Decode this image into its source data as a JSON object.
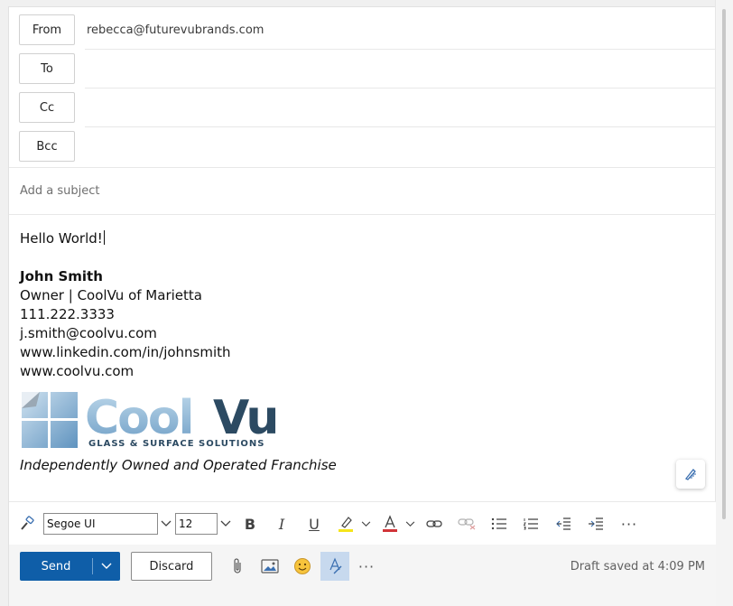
{
  "header": {
    "from_label": "From",
    "from_value": "rebecca@futurevubrands.com",
    "to_label": "To",
    "cc_label": "Cc",
    "bcc_label": "Bcc",
    "subject_placeholder": "Add a subject"
  },
  "body": {
    "greeting": "Hello World!",
    "signature": {
      "name": "John Smith",
      "title": "Owner | CoolVu of Marietta",
      "phone": "111.222.3333",
      "email": "j.smith@coolvu.com",
      "linkedin": "www.linkedin.com/in/johnsmith",
      "website": "www.coolvu.com",
      "logo_text": "CoolVu",
      "logo_tagline": "GLASS & SURFACE SOLUTIONS",
      "footer": "Independently Owned and Operated Franchise"
    }
  },
  "format_toolbar": {
    "font_name": "Segoe UI",
    "font_size": "12"
  },
  "actions": {
    "send_label": "Send",
    "discard_label": "Discard",
    "draft_status": "Draft saved at 4:09 PM"
  },
  "colors": {
    "send_blue": "#0f5ea8",
    "logo_navy": "#2c4a62",
    "logo_light": "#9ec3de"
  }
}
